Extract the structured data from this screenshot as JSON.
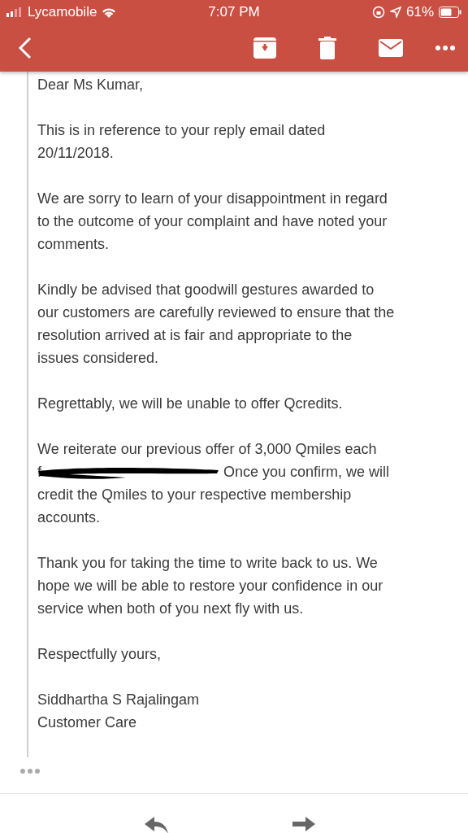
{
  "status_bar": {
    "carrier": "Lycamobile",
    "time": "7:07 PM",
    "battery": "61%"
  },
  "email": {
    "paragraphs": [
      {
        "kind": "text",
        "lines": [
          "Dear Ms Kumar,"
        ]
      },
      {
        "kind": "text",
        "lines": [
          "This is in reference to your reply email dated",
          "20/11/2018."
        ]
      },
      {
        "kind": "text",
        "lines": [
          "We are sorry to learn of your disappointment in regard",
          "to the outcome of your complaint and have noted your",
          "comments."
        ]
      },
      {
        "kind": "text",
        "lines": [
          "Kindly be advised that goodwill gestures awarded to",
          "our customers are carefully reviewed to ensure that the",
          "resolution arrived at is fair and appropriate to the",
          "issues considered."
        ]
      },
      {
        "kind": "text",
        "lines": [
          "Regrettably, we will be unable to offer Qcredits."
        ]
      },
      {
        "kind": "redacted",
        "lines_before": [
          "We reiterate our previous offer of 3,000 Qmiles each"
        ],
        "redacted_start": "f",
        "redacted_end": "Once you confirm, we will",
        "lines_after": [
          "credit the Qmiles to your respective membership",
          "accounts."
        ]
      },
      {
        "kind": "text",
        "lines": [
          "Thank you for taking the time to write back to us. We",
          "hope we will be able to restore your confidence in our",
          "service when both of you next fly with us."
        ]
      },
      {
        "kind": "text",
        "lines": [
          "Respectfully yours,"
        ]
      },
      {
        "kind": "text",
        "lines": [
          "Siddhartha S Rajalingam",
          "Customer Care"
        ]
      }
    ]
  }
}
